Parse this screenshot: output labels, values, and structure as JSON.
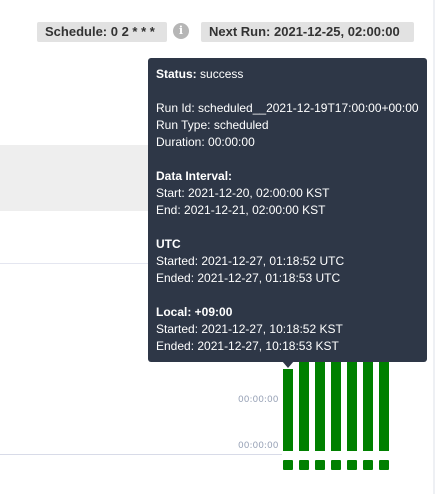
{
  "header": {
    "schedule": "Schedule: 0 2 * * *",
    "next_run": "Next Run: 2021-12-25, 02:00:00",
    "info_icon_glyph": "i"
  },
  "axis": {
    "labels": [
      "00:00:00",
      "00:00:00"
    ]
  },
  "tooltip": {
    "status_label": "Status:",
    "status_value": "success",
    "run_id": "Run Id: scheduled__2021-12-19T17:00:00+00:00",
    "run_type": "Run Type: scheduled",
    "duration": "Duration: 00:00:00",
    "data_interval_heading": "Data Interval:",
    "data_interval_start": "Start: 2021-12-20, 02:00:00 KST",
    "data_interval_end": "End: 2021-12-21, 02:00:00 KST",
    "utc_heading": "UTC",
    "utc_started": "Started: 2021-12-27, 01:18:52 UTC",
    "utc_ended": "Ended: 2021-12-27, 01:18:53 UTC",
    "local_heading": "Local: +09:00",
    "local_started": "Started: 2021-12-27, 10:18:52 KST",
    "local_ended": "Ended: 2021-12-27, 10:18:53 KST"
  },
  "runs": {
    "count": 7,
    "status": "success",
    "color": "#008000"
  },
  "colors": {
    "tooltip_bg": "#2e3747",
    "badge_bg": "#e2e2e2",
    "success": "#008000"
  }
}
